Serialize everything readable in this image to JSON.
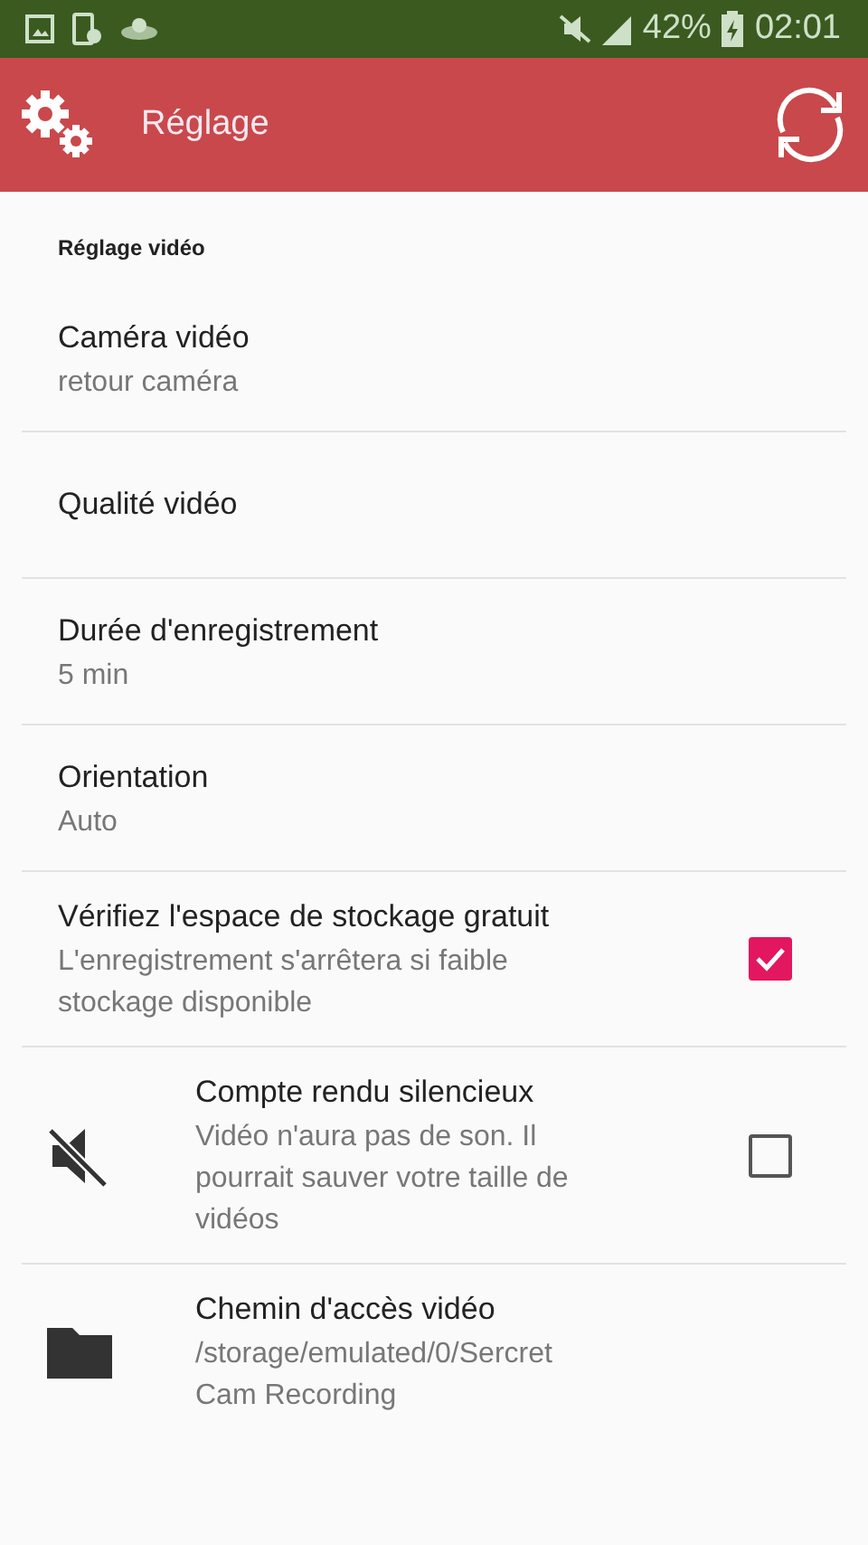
{
  "status_bar": {
    "battery": "42%",
    "time": "02:01"
  },
  "app_bar": {
    "title": "Réglage"
  },
  "section": {
    "title": "Réglage vidéo"
  },
  "items": [
    {
      "kind": "text",
      "title": "Caméra vidéo",
      "summary": "retour caméra"
    },
    {
      "kind": "text",
      "title": "Qualité vidéo"
    },
    {
      "kind": "text",
      "title": "Durée d'enregistrement",
      "summary": "5 min"
    },
    {
      "kind": "text",
      "title": "Orientation",
      "summary": "Auto"
    },
    {
      "kind": "checkbox",
      "title": "Vérifiez l'espace de stockage gratuit",
      "summary": "L'enregistrement s'arrêtera si faible stockage disponible",
      "checked": true
    },
    {
      "kind": "sound",
      "title": "Compte rendu silencieux",
      "summary": "Vidéo n'aura pas de son. Il pourrait sauver votre taille de vidéos",
      "checked": false
    },
    {
      "kind": "folder",
      "title": "Chemin d'accès vidéo",
      "summary": "/storage/emulated/0/Sercret Cam Recording"
    }
  ]
}
